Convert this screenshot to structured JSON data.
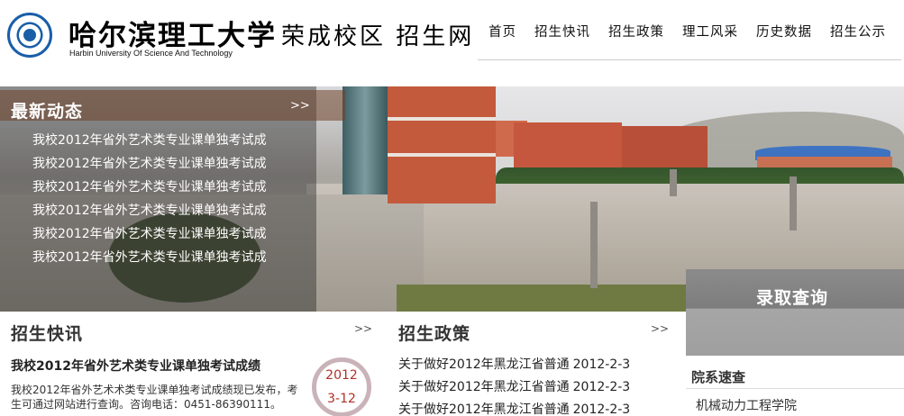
{
  "header": {
    "logo_cn": "哈尔滨理工大学",
    "logo_en": "Harbin University Of Science And Technology",
    "site_name": "荣成校区 招生网"
  },
  "nav": [
    "首页",
    "招生快讯",
    "招生政策",
    "理工风采",
    "历史数据",
    "招生公示"
  ],
  "latest_news": {
    "title": "最新动态",
    "more": ">>",
    "items": [
      "我校2012年省外艺术类专业课单独考试成",
      "我校2012年省外艺术类专业课单独考试成",
      "我校2012年省外艺术类专业课单独考试成",
      "我校2012年省外艺术类专业课单独考试成",
      "我校2012年省外艺术类专业课单独考试成",
      "我校2012年省外艺术类专业课单独考试成"
    ]
  },
  "admission_news": {
    "title": "招生快讯",
    "more": ">>",
    "headline": "我校2012年省外艺术类专业课单独考试成绩",
    "summary": "我校2012年省外艺术术类专业课单独考试成绩现已发布，考生可通过网站进行查询。咨询电话：0451-86390111。",
    "date_year": "2012",
    "date_md": "3-12"
  },
  "admission_policy": {
    "title": "招生政策",
    "more": ">>",
    "items": [
      {
        "text": "关于做好2012年黑龙江省普通",
        "date": "2012-2-3"
      },
      {
        "text": "关于做好2012年黑龙江省普通",
        "date": "2012-2-3"
      },
      {
        "text": "关于做好2012年黑龙江省普通",
        "date": "2012-2-3"
      }
    ]
  },
  "query": {
    "title": "录取查询",
    "dept_heading": "院系速查",
    "dept_item": "机械动力工程学院"
  }
}
